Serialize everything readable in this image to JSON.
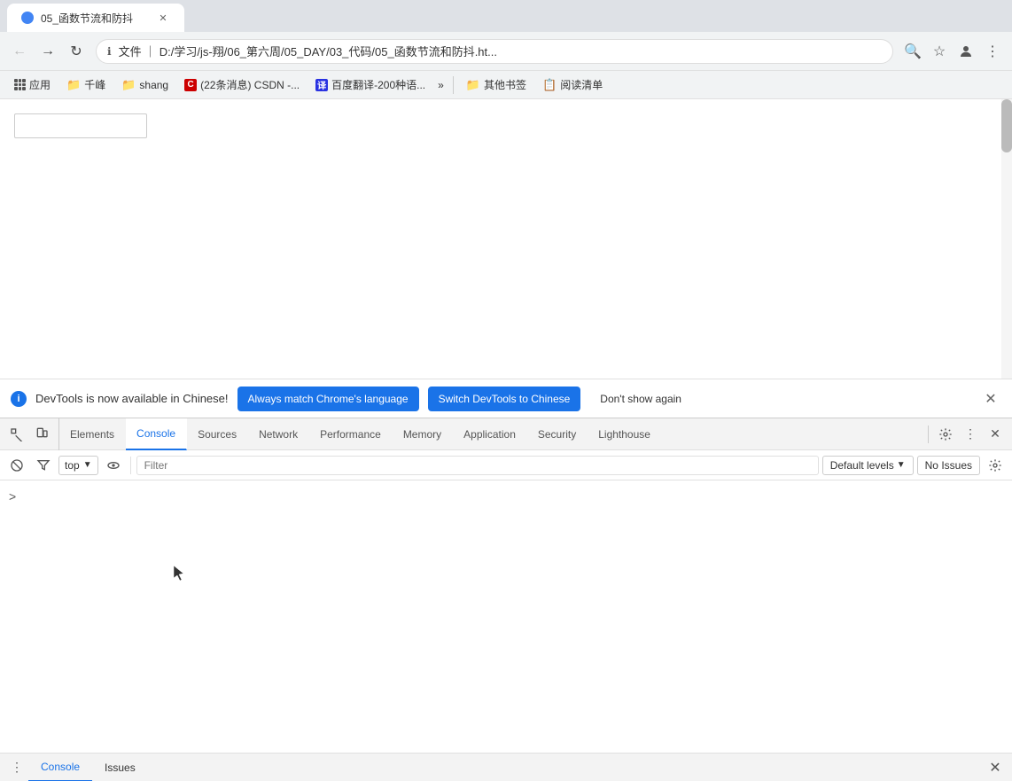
{
  "browser": {
    "tab": {
      "title": "05_函数节流和防抖",
      "favicon_color": "#4285f4"
    },
    "address": {
      "protocol_icon": "ℹ",
      "url": "文件 ｜ D:/学习/js-翔/06_第六周/05_DAY/03_代码/05_函数节流和防抖.ht...",
      "search_icon": "🔍"
    },
    "toolbar_icons": {
      "search": "🔍",
      "bookmark": "☆",
      "profile": "👤",
      "menu": "⋮"
    },
    "bookmarks": [
      {
        "id": "apps",
        "label": "应用",
        "type": "apps"
      },
      {
        "id": "qianfeng",
        "label": "千峰",
        "type": "folder",
        "color": "#f9ab00"
      },
      {
        "id": "shang",
        "label": "shang",
        "type": "folder",
        "color": "#f9ab00"
      },
      {
        "id": "csdn",
        "label": "(22条消息) CSDN -...",
        "type": "site",
        "color": "#c00"
      },
      {
        "id": "baidu",
        "label": "百度翻译-200种语...",
        "type": "site",
        "color": "#2932e1"
      },
      {
        "id": "more",
        "label": "»",
        "type": "more"
      },
      {
        "id": "other",
        "label": "其他书签",
        "type": "folder",
        "color": "#f9ab00"
      },
      {
        "id": "read",
        "label": "阅读清单",
        "type": "folder",
        "color": "#555"
      }
    ]
  },
  "page": {
    "input_placeholder": ""
  },
  "devtools_notification": {
    "icon": "i",
    "text": "DevTools is now available in Chinese!",
    "btn_match": "Always match Chrome's language",
    "btn_switch": "Switch DevTools to Chinese",
    "btn_nodont": "Don't show again"
  },
  "devtools": {
    "tabs": [
      {
        "id": "elements",
        "label": "Elements",
        "active": false
      },
      {
        "id": "console",
        "label": "Console",
        "active": true
      },
      {
        "id": "sources",
        "label": "Sources",
        "active": false
      },
      {
        "id": "network",
        "label": "Network",
        "active": false
      },
      {
        "id": "performance",
        "label": "Performance",
        "active": false
      },
      {
        "id": "memory",
        "label": "Memory",
        "active": false
      },
      {
        "id": "application",
        "label": "Application",
        "active": false
      },
      {
        "id": "security",
        "label": "Security",
        "active": false
      },
      {
        "id": "lighthouse",
        "label": "Lighthouse",
        "active": false
      }
    ],
    "console": {
      "context": "top",
      "filter_placeholder": "Filter",
      "levels_label": "Default levels",
      "issues_label": "No Issues"
    }
  },
  "bottom_tabs": [
    {
      "id": "console",
      "label": "Console",
      "active": true
    },
    {
      "id": "issues",
      "label": "Issues",
      "active": false
    }
  ]
}
